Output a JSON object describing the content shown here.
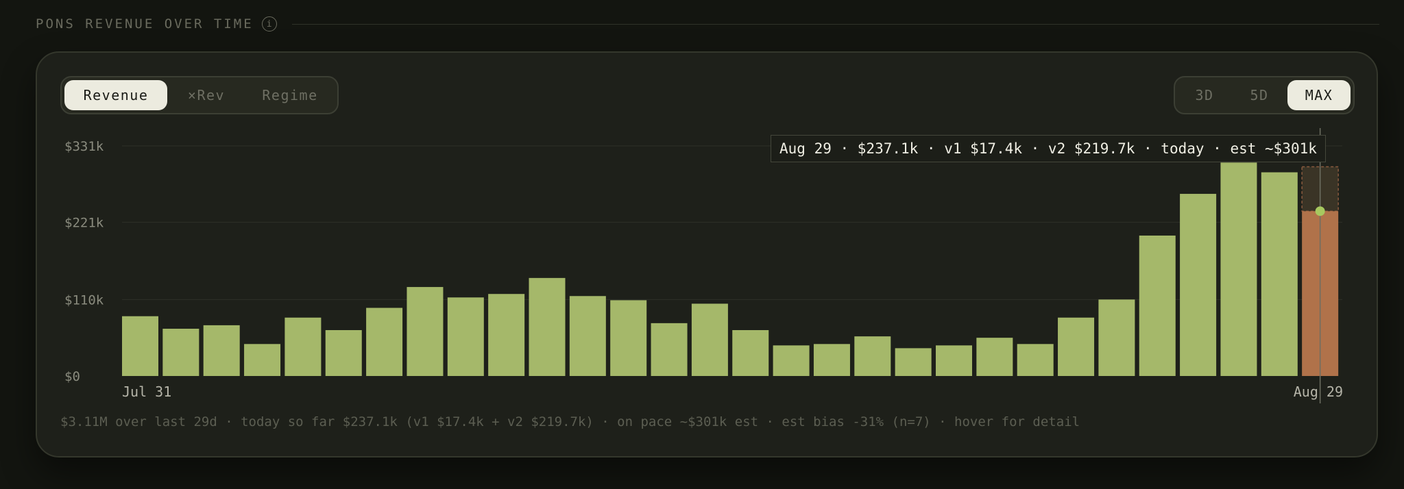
{
  "header": {
    "title": "PONS REVENUE OVER TIME",
    "info_glyph": "i"
  },
  "controls": {
    "metric_tabs": [
      "Revenue",
      "×Rev",
      "Regime"
    ],
    "metric_active": 0,
    "range_tabs": [
      "3D",
      "5D",
      "MAX"
    ],
    "range_active": 2
  },
  "tooltip": {
    "text": "Aug 29 · $237.1k · v1 $17.4k · v2 $219.7k · today · est ~$301k"
  },
  "footer": {
    "summary": "$3.11M over last 29d · today so far $237.1k (v1 $17.4k + v2 $219.7k) · on pace ~$301k est · est bias -31% (n=7) · hover for detail"
  },
  "colors": {
    "bar": "#a5b86a",
    "today_bar": "#b0724a",
    "estimate_box": "#3a3426",
    "estimate_border": "#8a5a3e",
    "marker": "#a7c85f",
    "grid": "#2e3128",
    "cursor_line": "#6d6f63"
  },
  "chart_data": {
    "type": "bar",
    "x_start_label": "Jul 31",
    "x_end_label": "Aug 29",
    "y_ticks": [
      {
        "value": 0,
        "label": "$0"
      },
      {
        "value": 110,
        "label": "$110k"
      },
      {
        "value": 221,
        "label": "$221k"
      },
      {
        "value": 331,
        "label": "$331k"
      }
    ],
    "ylim": [
      0,
      331
    ],
    "unit": "$k",
    "values": [
      86,
      68,
      73,
      46,
      84,
      66,
      98,
      128,
      113,
      118,
      141,
      115,
      109,
      76,
      104,
      66,
      44,
      46,
      57,
      40,
      44,
      55,
      46,
      84,
      110,
      202,
      262,
      307,
      293,
      237.1
    ],
    "highlight_index": 29,
    "highlight_estimate": 301,
    "grid": true
  }
}
